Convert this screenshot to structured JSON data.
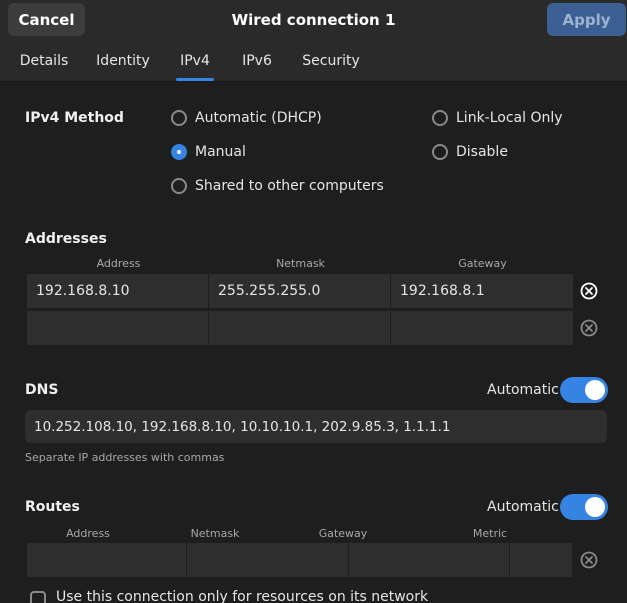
{
  "header": {
    "cancel_label": "Cancel",
    "title": "Wired connection 1",
    "apply_label": "Apply"
  },
  "tabs": [
    {
      "label": "Details"
    },
    {
      "label": "Identity"
    },
    {
      "label": "IPv4",
      "active": true
    },
    {
      "label": "IPv6"
    },
    {
      "label": "Security"
    }
  ],
  "method": {
    "label": "IPv4 Method",
    "options": [
      {
        "label": "Automatic (DHCP)",
        "selected": false
      },
      {
        "label": "Manual",
        "selected": true
      },
      {
        "label": "Shared to other computers",
        "selected": false
      },
      {
        "label": "Link-Local Only",
        "selected": false
      },
      {
        "label": "Disable",
        "selected": false
      }
    ]
  },
  "addresses": {
    "label": "Addresses",
    "columns": [
      "Address",
      "Netmask",
      "Gateway"
    ],
    "rows": [
      [
        "192.168.8.10",
        "255.255.255.0",
        "192.168.8.1"
      ],
      [
        "",
        "",
        ""
      ]
    ]
  },
  "dns": {
    "label": "DNS",
    "automatic_label": "Automatic",
    "automatic": true,
    "value": "10.252.108.10, 192.168.8.10, 10.10.10.1, 202.9.85.3, 1.1.1.1",
    "hint": "Separate IP addresses with commas"
  },
  "routes": {
    "label": "Routes",
    "automatic_label": "Automatic",
    "automatic": true,
    "columns": [
      "Address",
      "Netmask",
      "Gateway",
      "Metric"
    ],
    "rows": [
      [
        "",
        "",
        "",
        ""
      ]
    ],
    "use_only_label": "Use this connection only for resources on its network"
  },
  "colors": {
    "accent": "#3584e4",
    "background": "#1e1e1e",
    "headerbar": "#2a2a2a",
    "entry": "#2e2e2e"
  }
}
